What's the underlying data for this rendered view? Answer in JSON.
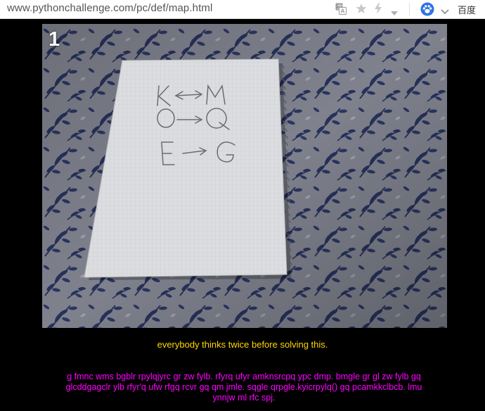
{
  "browser": {
    "url": "www.pythonchallenge.com/pc/def/map.html",
    "search_engine_label": "百度",
    "icons": [
      "translate-icon",
      "star-icon",
      "lightning-icon",
      "dropdown-chevron-icon",
      "paw-icon",
      "chevron-down-icon"
    ]
  },
  "page": {
    "image_number": "1",
    "image_drawing_text": [
      "K→M",
      "O→Q",
      "E→G"
    ],
    "caption": "everybody thinks twice before solving this.",
    "cipher_text": "g fmnc wms bgblr rpylqjyrc gr zw fylb. rfyrq ufyr amknsrcpq ypc dmp. bmgle gr gl zw fylb gq glcddgagclr ylb rfyr'q ufw rfgq rcvr gq qm jmle. sqgle qrpgle.kyicrpylq() gq pcamkkclbcb. lmu ynnjw ml rfc spj."
  },
  "colors": {
    "background": "#000000",
    "caption": "#ffd700",
    "cipher": "#ff00ff"
  }
}
